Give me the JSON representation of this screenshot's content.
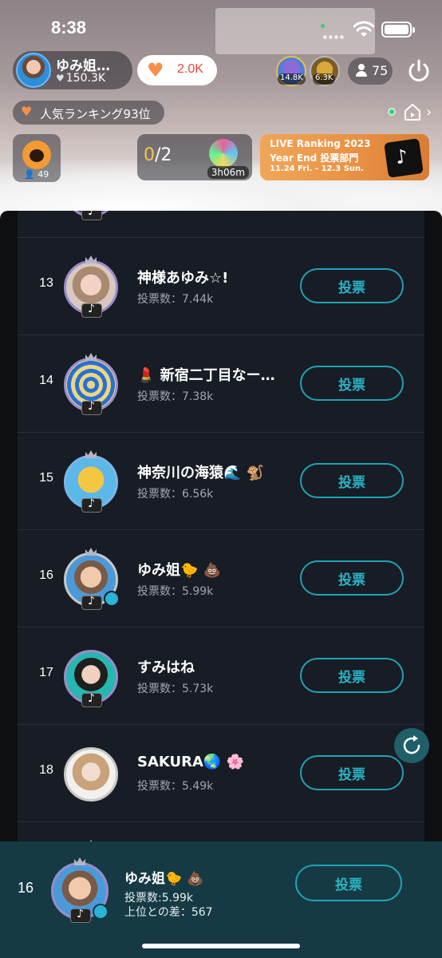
{
  "status_bar": {
    "time": "8:38"
  },
  "host": {
    "name": "ゆみ姐…",
    "likes": "150.3K",
    "like_count": "2.0K"
  },
  "top_viewers": [
    {
      "badge": "14.8K"
    },
    {
      "badge": "6.3K"
    }
  ],
  "viewer_count": "75",
  "popularity_ranking": "人気ランキング93位",
  "team": {
    "count": "49"
  },
  "goal": {
    "current": "0",
    "total": "/2",
    "timer": "3h06m"
  },
  "promo": {
    "line1": "LIVE Ranking 2023",
    "line2": "Year End 投票部門",
    "line3": "11.24 Fri. - 12.3 Sun."
  },
  "ranking": {
    "vote_label": "投票",
    "rows": [
      {
        "rank": "13",
        "name": "神様あゆみ☆!",
        "votes": "投票数：7.44k"
      },
      {
        "rank": "14",
        "name": "💄 新宿二丁目なー…",
        "votes": "投票数：7.38k"
      },
      {
        "rank": "15",
        "name": "神奈川の海猿🌊 🐒",
        "votes": "投票数：6.56k"
      },
      {
        "rank": "16",
        "name": "ゆみ姐🐤 💩",
        "votes": "投票数：5.99k"
      },
      {
        "rank": "17",
        "name": "すみはね",
        "votes": "投票数：5.73k"
      },
      {
        "rank": "18",
        "name": "SAKURA🌏 🌸",
        "votes": "投票数：5.49k"
      }
    ]
  },
  "my_entry": {
    "rank": "16",
    "name": "ゆみ姐🐤 💩",
    "votes": "投票数:5.99k",
    "gap": "上位との差：567",
    "vote_label": "投票"
  },
  "colors": {
    "accent_teal": "#2ab3c5",
    "list_bg": "#171c25",
    "my_bar_bg": "#153a44",
    "like_orange": "#f5904a"
  }
}
